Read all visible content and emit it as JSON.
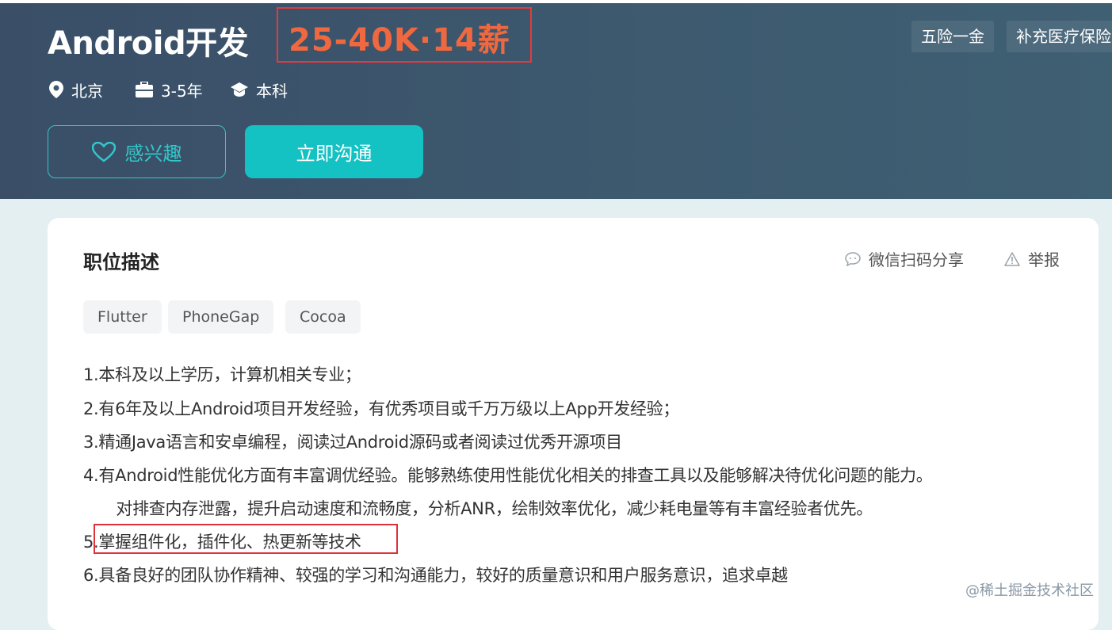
{
  "job": {
    "title": "Android开发",
    "salary": "25-40K·14薪",
    "meta": {
      "location": "北京",
      "experience": "3-5年",
      "education": "本科"
    },
    "welfare": [
      "五险一金",
      "补充医疗保险"
    ]
  },
  "actions": {
    "interest_label": "感兴趣",
    "chat_label": "立即沟通"
  },
  "description": {
    "title": "职位描述",
    "share_label": "微信扫码分享",
    "report_label": "举报",
    "tags": [
      "Flutter",
      "PhoneGap",
      "Cocoa"
    ],
    "lines": [
      "1.本科及以上学历，计算机相关专业；",
      "2.有6年及以上Android项目开发经验，有优秀项目或千万万级以上App开发经验；",
      "3.精通Java语言和安卓编程，阅读过Android源码或者阅读过优秀开源项目",
      "4.有Android性能优化方面有丰富调优经验。能够熟练使用性能优化相关的排查工具以及能够解决待优化问题的能力。",
      "　　对排查内存泄露，提升启动速度和流畅度，分析ANR，绘制效率优化，减少耗电量等有丰富经验者优先。",
      "5.掌握组件化，插件化、热更新等技术",
      "6.具备良好的团队协作精神、较强的学习和沟通能力，较好的质量意识和用户服务意识，追求卓越"
    ]
  },
  "watermark": "@稀土掘金技术社区",
  "colors": {
    "header_bg": "#3d5a6f",
    "salary": "#f0683f",
    "accent": "#14c1c3",
    "annotation_red": "#e0303a"
  }
}
